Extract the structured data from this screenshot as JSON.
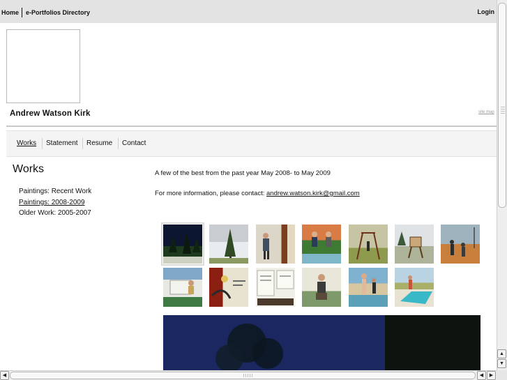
{
  "topbar": {
    "home": "Home",
    "directory": "e-Portfolios Directory",
    "login": "Login"
  },
  "header": {
    "artist_name": "Andrew Watson Kirk",
    "sitemap": "site map"
  },
  "nav": {
    "items": [
      {
        "label": "Works",
        "active": true
      },
      {
        "label": "Statement"
      },
      {
        "label": "Resume"
      },
      {
        "label": "Contact"
      }
    ]
  },
  "section": {
    "title": "Works"
  },
  "sidebar": {
    "links": [
      {
        "label": "Paintings: Recent Work"
      },
      {
        "label": "Paintings: 2008-2009",
        "active": true
      },
      {
        "label": "Older Work: 2005-2007"
      }
    ]
  },
  "content": {
    "intro": "A few of the best from the past year May 2008- to May 2009",
    "contact_prefix": "For more information, please contact: ",
    "contact_email": "andrew.watson.kirk@gmail.com"
  },
  "thumbnails": [
    {
      "name": "night-forest-painting",
      "selected": true
    },
    {
      "name": "pine-tree-snow-painting"
    },
    {
      "name": "man-doorway-painting"
    },
    {
      "name": "figures-pool-painting"
    },
    {
      "name": "swing-frame-painting"
    },
    {
      "name": "easel-landscape-painting"
    },
    {
      "name": "figures-misty-field-painting"
    },
    {
      "name": "woman-reading-painting"
    },
    {
      "name": "red-abstract-painting"
    },
    {
      "name": "notes-papers-painting"
    },
    {
      "name": "seated-man-painting"
    },
    {
      "name": "standing-figures-painting"
    },
    {
      "name": "swimming-pool-painting"
    }
  ],
  "icons": {
    "scroll_up": "up-arrow-icon",
    "scroll_down": "down-arrow-icon",
    "scroll_left": "left-arrow-icon",
    "scroll_right": "right-arrow-icon"
  }
}
